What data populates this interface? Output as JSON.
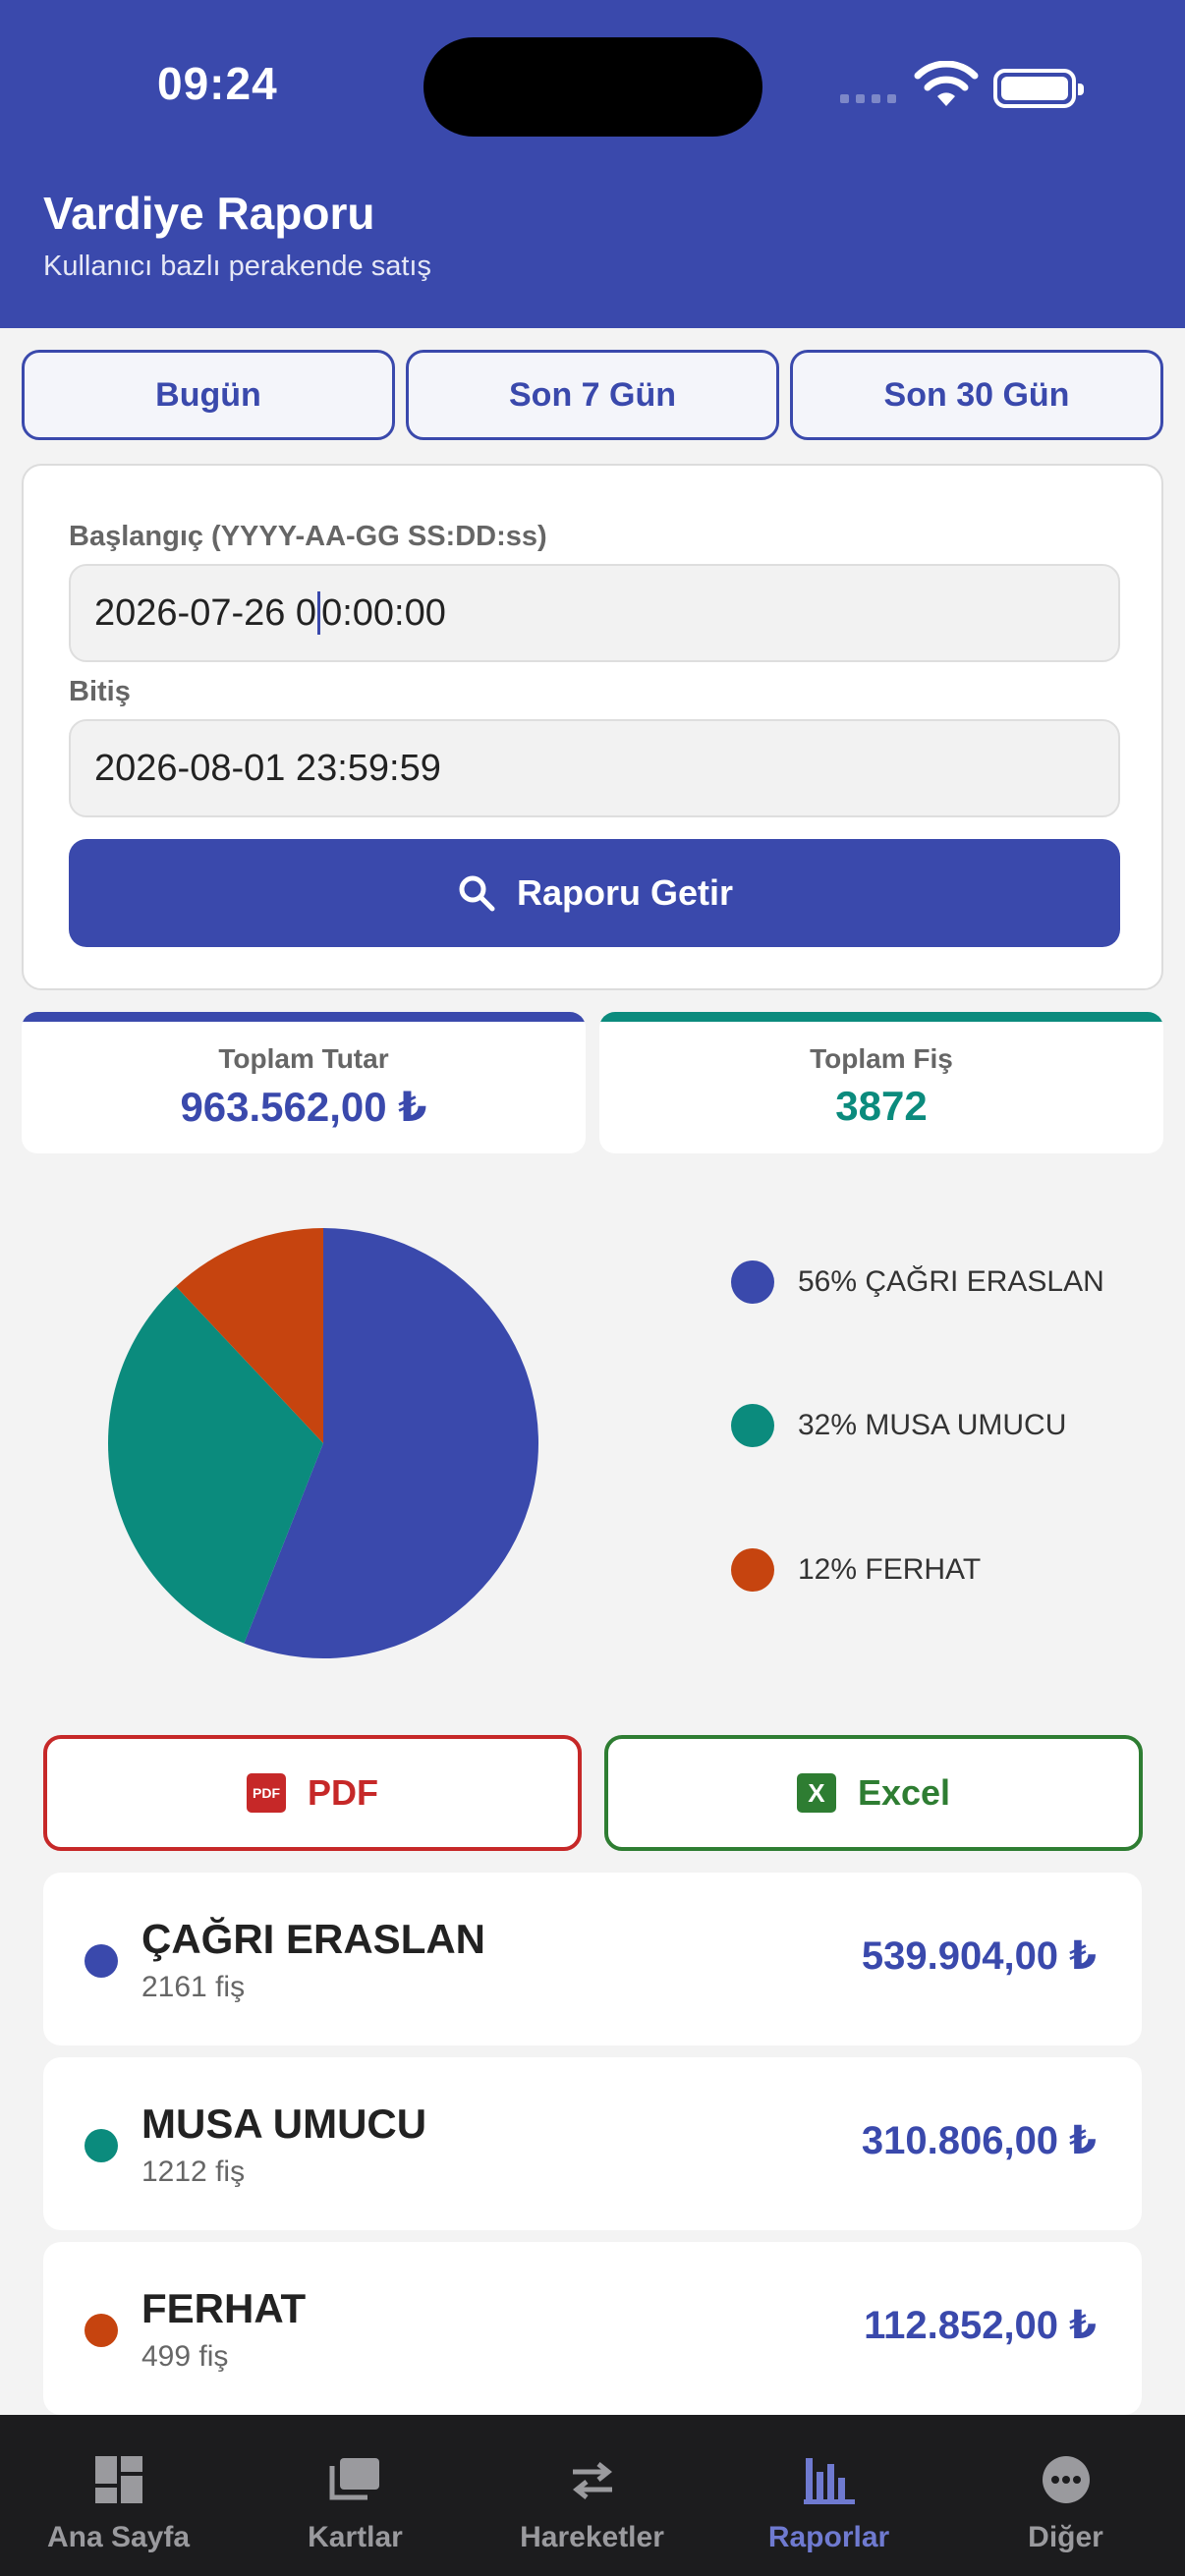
{
  "status_bar": {
    "time": "09:24"
  },
  "header": {
    "title": "Vardiye Raporu",
    "subtitle": "Kullanıcı bazlı perakende satış"
  },
  "quick_ranges": [
    "Bugün",
    "Son 7 Gün",
    "Son 30 Gün"
  ],
  "date_form": {
    "start_label": "Başlangıç (YYYY-AA-GG SS:DD:ss)",
    "start_value_before_caret": "2026-07-26 0",
    "start_value_after_caret": "0:00:00",
    "end_label": "Bitiş",
    "end_value": "2026-08-01 23:59:59",
    "fetch_label": "Raporu Getir"
  },
  "summary": {
    "total_amount_label": "Toplam Tutar",
    "total_amount_value": "963.562,00 ₺",
    "total_receipts_label": "Toplam Fiş",
    "total_receipts_value": "3872"
  },
  "colors": {
    "primary": "#3a49ac",
    "teal": "#0b8b7d",
    "orange": "#c6440f",
    "pdf": "#c62828",
    "excel": "#2e7d32"
  },
  "chart_data": {
    "type": "pie",
    "categories": [
      "ÇAĞRI ERASLAN",
      "MUSA UMUCU",
      "FERHAT"
    ],
    "values": [
      56,
      32,
      12
    ],
    "colors": [
      "#3a49ac",
      "#0b8b7d",
      "#c6440f"
    ],
    "legend_labels": [
      "56% ÇAĞRI ERASLAN",
      "32% MUSA UMUCU",
      "12% FERHAT"
    ],
    "legend_position": "right"
  },
  "export": {
    "pdf_label": "PDF",
    "pdf_icon_text": "PDF",
    "excel_label": "Excel",
    "excel_icon_text": "X"
  },
  "users": [
    {
      "name": "ÇAĞRI ERASLAN",
      "receipts": "2161 fiş",
      "amount": "539.904,00 ₺",
      "color": "#3a49ac"
    },
    {
      "name": "MUSA UMUCU",
      "receipts": "1212 fiş",
      "amount": "310.806,00 ₺",
      "color": "#0b8b7d"
    },
    {
      "name": "FERHAT",
      "receipts": "499 fiş",
      "amount": "112.852,00 ₺",
      "color": "#c6440f"
    }
  ],
  "tabs": [
    {
      "label": "Ana Sayfa",
      "icon": "dashboard-icon"
    },
    {
      "label": "Kartlar",
      "icon": "cards-icon"
    },
    {
      "label": "Hareketler",
      "icon": "transfer-arrows-icon"
    },
    {
      "label": "Raporlar",
      "icon": "bar-chart-icon",
      "active": true
    },
    {
      "label": "Diğer",
      "icon": "more-icon"
    }
  ]
}
